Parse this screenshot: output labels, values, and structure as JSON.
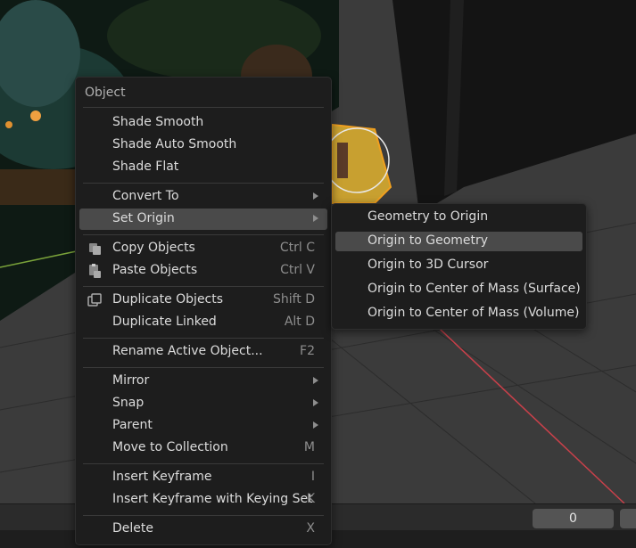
{
  "menu": {
    "title": "Object",
    "items": [
      {
        "label": "Shade Smooth",
        "shortcut": ""
      },
      {
        "label": "Shade Auto Smooth",
        "shortcut": ""
      },
      {
        "label": "Shade Flat",
        "shortcut": ""
      },
      {
        "label": "Convert To",
        "shortcut": "",
        "submenu": true
      },
      {
        "label": "Set Origin",
        "shortcut": "",
        "submenu": true,
        "highlighted": true
      },
      {
        "label": "Copy Objects",
        "shortcut": "Ctrl C",
        "icon": "copy-icon"
      },
      {
        "label": "Paste Objects",
        "shortcut": "Ctrl V",
        "icon": "paste-icon"
      },
      {
        "label": "Duplicate Objects",
        "shortcut": "Shift D",
        "icon": "duplicate-icon"
      },
      {
        "label": "Duplicate Linked",
        "shortcut": "Alt D"
      },
      {
        "label": "Rename Active Object...",
        "shortcut": "F2"
      },
      {
        "label": "Mirror",
        "shortcut": "",
        "submenu": true
      },
      {
        "label": "Snap",
        "shortcut": "",
        "submenu": true
      },
      {
        "label": "Parent",
        "shortcut": "",
        "submenu": true
      },
      {
        "label": "Move to Collection",
        "shortcut": "M"
      },
      {
        "label": "Insert Keyframe",
        "shortcut": "I"
      },
      {
        "label": "Insert Keyframe with Keying Set",
        "shortcut": "K"
      },
      {
        "label": "Delete",
        "shortcut": "X"
      }
    ]
  },
  "submenu": {
    "items": [
      {
        "label": "Geometry to Origin"
      },
      {
        "label": "Origin to Geometry",
        "highlighted": true
      },
      {
        "label": "Origin to 3D Cursor"
      },
      {
        "label": "Origin to Center of Mass (Surface)"
      },
      {
        "label": "Origin to Center of Mass (Volume)"
      }
    ]
  },
  "timeline": {
    "current_frame": "0"
  },
  "colors": {
    "menu_bg": "#1d1d1d",
    "highlight": "#4a4a4a",
    "x_axis": "#c8404a",
    "y_axis": "#7aa33a",
    "selection_outline": "#f0a020"
  }
}
